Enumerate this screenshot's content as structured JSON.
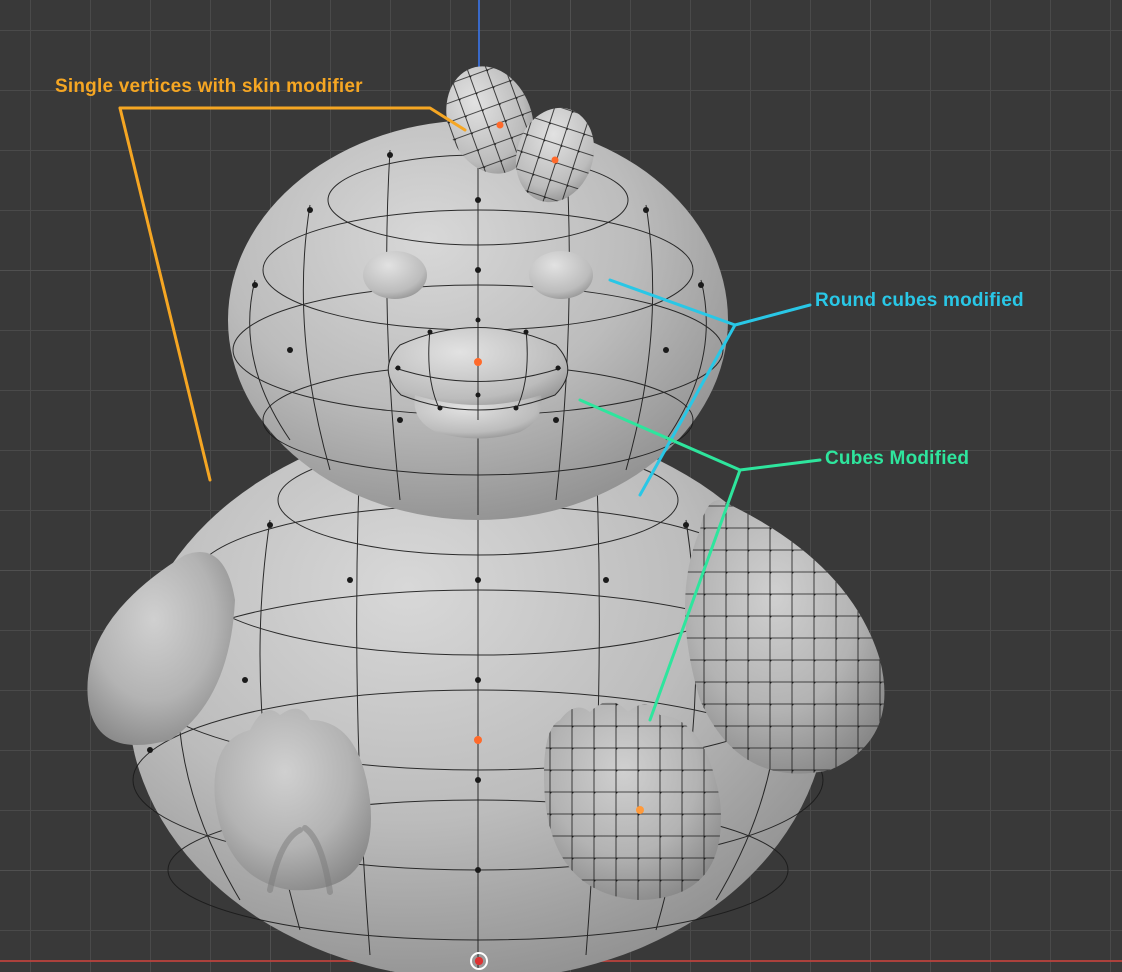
{
  "annotations": {
    "skin": {
      "text": "Single vertices with skin modifier",
      "color": "#f5a623"
    },
    "round": {
      "text": "Round cubes modified",
      "color": "#29c7e6"
    },
    "cubes": {
      "text": "Cubes Modified",
      "color": "#2ee59d"
    }
  },
  "colors": {
    "background": "#393939",
    "grid": "#4a4a4a",
    "axis_y": "#3a6fd8",
    "axis_x": "#b9423d",
    "mesh": "#b9b9b9",
    "wire": "#1a1a1a",
    "vertex": "#1a1a1a",
    "origin": "#ff6a2b"
  }
}
